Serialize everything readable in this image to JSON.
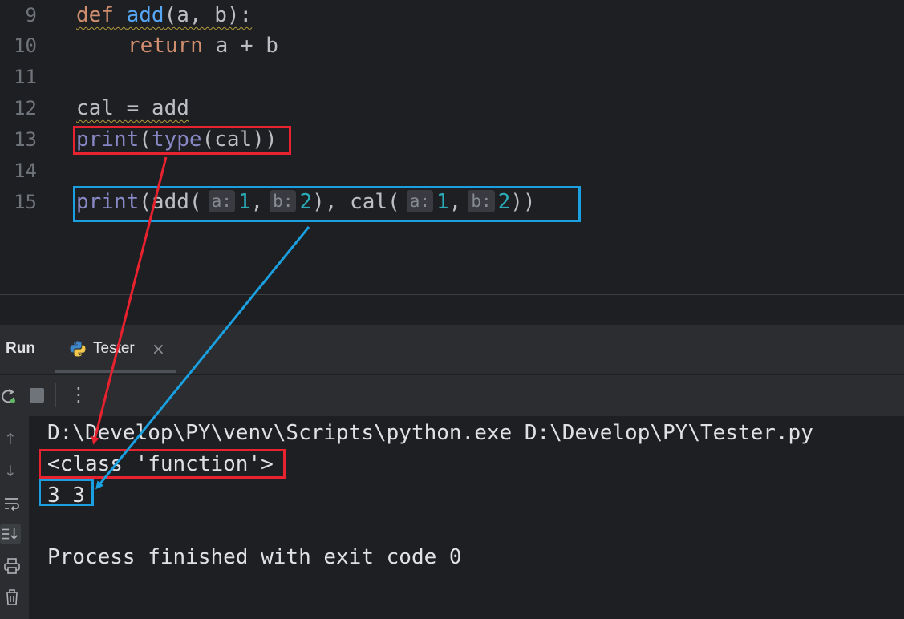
{
  "editor": {
    "line_numbers": [
      "9",
      "10",
      "11",
      "12",
      "13",
      "14",
      "15"
    ],
    "line9": {
      "def": "def",
      "name": "add",
      "params": "(a, b):"
    },
    "line10": {
      "ret": "return",
      "expr": " a + b"
    },
    "line12": {
      "text": "cal = add"
    },
    "line13": {
      "print": "print",
      "open": "(",
      "type": "type",
      "rest": "(cal))"
    },
    "line15": {
      "print": "print",
      "p1": "(add(",
      "hint_a": "a:",
      "v1": "1",
      "comma1": ",",
      "hint_b": "b:",
      "v2": "2",
      "p2": "), cal(",
      "hint_a2": "a:",
      "v3": "1",
      "comma2": ",",
      "hint_b2": "b:",
      "v4": "2",
      "close": "))"
    }
  },
  "run_panel": {
    "title": "Run",
    "tab_label": "Tester",
    "tab_close": "×",
    "menu_icon": "⋮"
  },
  "console": {
    "cmd": "D:\\Develop\\PY\\venv\\Scripts\\python.exe D:\\Develop\\PY\\Tester.py",
    "out1": "<class 'function'>",
    "out2": "3 3",
    "finish": "Process finished with exit code 0"
  },
  "colors": {
    "red_annotation": "#e8222e",
    "blue_annotation": "#1aa0e0"
  },
  "icons": [
    "rerun-icon",
    "stop-icon",
    "more-icon",
    "python-icon",
    "close-icon",
    "up-arrow-icon",
    "down-arrow-icon",
    "soft-wrap-icon",
    "scroll-to-end-icon",
    "print-icon",
    "trash-icon"
  ]
}
